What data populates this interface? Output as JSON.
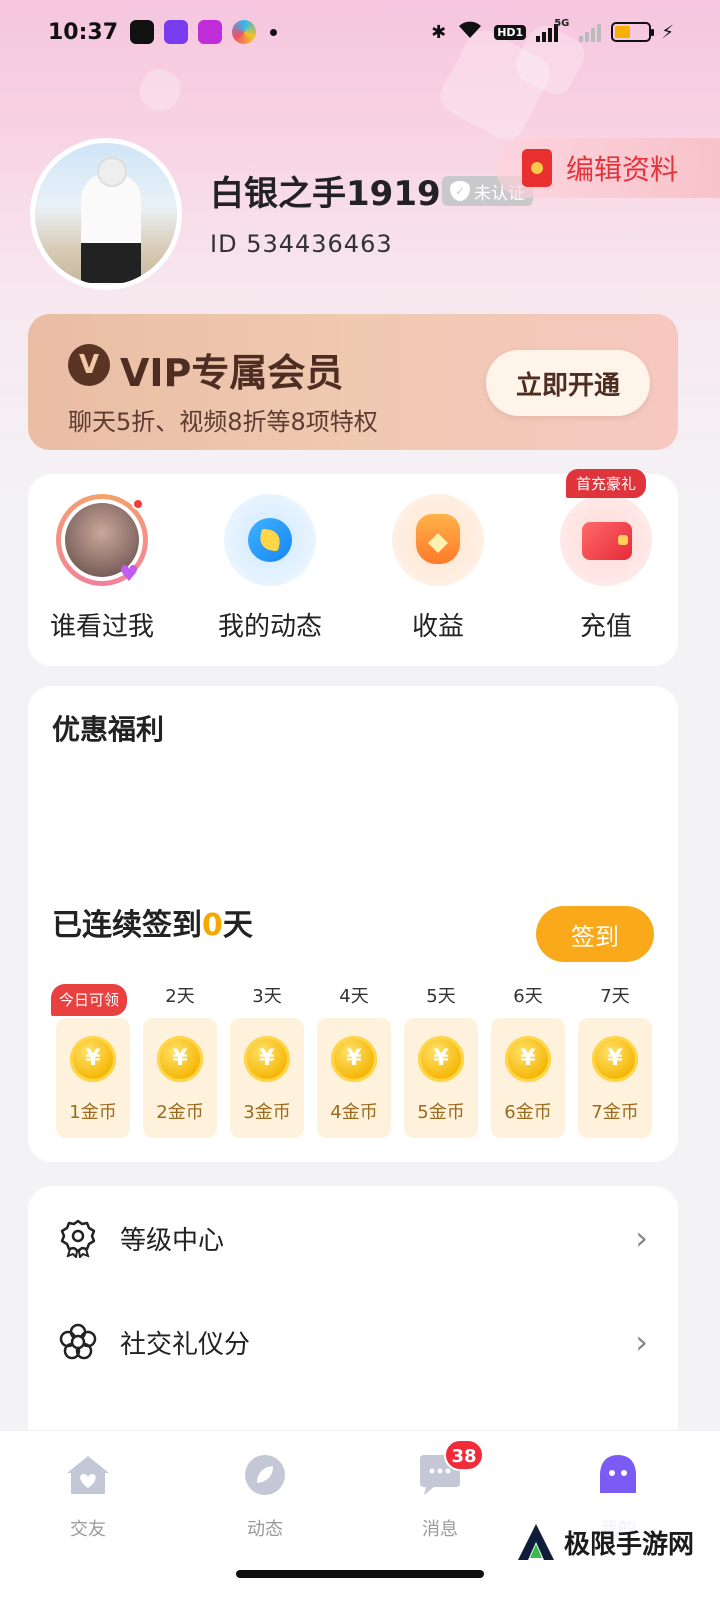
{
  "status_bar": {
    "time": "10:37",
    "hd_label": "HD1",
    "net_label": "5G",
    "battery_level": 0.45
  },
  "profile": {
    "nickname": "白银之手1919",
    "verify_label": "未认证",
    "user_id": "ID 534436463",
    "edit_label": "编辑资料"
  },
  "vip": {
    "badge": "V",
    "title": "VIP专属会员",
    "subtitle": "聊天5折、视频8折等8项特权",
    "button": "立即开通"
  },
  "quick_actions": [
    {
      "label": "谁看过我",
      "icon": "avatar-viewer-icon"
    },
    {
      "label": "我的动态",
      "icon": "moments-icon"
    },
    {
      "label": "收益",
      "icon": "money-bag-icon"
    },
    {
      "label": "充值",
      "icon": "wallet-icon",
      "tag": "首充豪礼"
    }
  ],
  "benefits": {
    "title": "优惠福利",
    "streak_prefix": "已连续签到",
    "streak_days": "0",
    "streak_suffix": "天",
    "sign_button": "签到",
    "days": [
      {
        "label": "今日可领",
        "reward": "1金币",
        "today": true
      },
      {
        "label": "2天",
        "reward": "2金币"
      },
      {
        "label": "3天",
        "reward": "3金币"
      },
      {
        "label": "4天",
        "reward": "4金币"
      },
      {
        "label": "5天",
        "reward": "5金币"
      },
      {
        "label": "6天",
        "reward": "6金币"
      },
      {
        "label": "7天",
        "reward": "7金币"
      }
    ],
    "coin_symbol": "¥"
  },
  "menu": [
    {
      "label": "等级中心",
      "icon": "level-badge-icon"
    },
    {
      "label": "社交礼仪分",
      "icon": "flower-icon"
    }
  ],
  "nav": {
    "items": [
      {
        "label": "交友",
        "icon": "home-heart-icon"
      },
      {
        "label": "动态",
        "icon": "leaf-icon"
      },
      {
        "label": "消息",
        "icon": "chat-bubble-icon",
        "badge": "38"
      },
      {
        "label": "我的",
        "icon": "profile-face-icon",
        "active": true
      }
    ]
  },
  "watermark": {
    "text": "极限手游网"
  },
  "colors": {
    "accent_orange": "#f9a91a",
    "accent_purple": "#7b5bf6",
    "alert_red": "#e9413f",
    "vip_brown": "#4e2d22"
  }
}
